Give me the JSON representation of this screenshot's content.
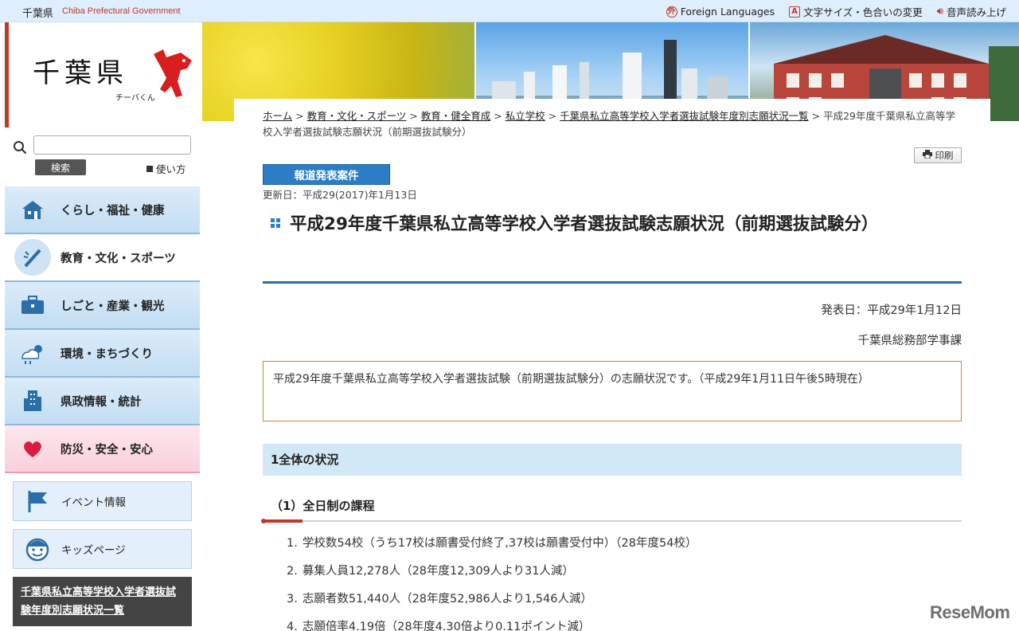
{
  "topbar": {
    "brand_ja": "千葉県",
    "brand_en": "Chiba Prefectural Government",
    "links": [
      "Foreign Languages",
      "文字サイズ・色合いの変更",
      "音声読み上げ"
    ]
  },
  "logo": {
    "text": "千葉県",
    "mascot_name": "チーバくん"
  },
  "search": {
    "placeholder": "",
    "button": "検索",
    "howto": "使い方"
  },
  "nav": [
    {
      "label": "くらし・福祉・健康",
      "icon": "house-icon"
    },
    {
      "label": "教育・文化・スポーツ",
      "icon": "pen-icon"
    },
    {
      "label": "しごと・産業・観光",
      "icon": "briefcase-icon"
    },
    {
      "label": "環境・まちづくり",
      "icon": "weather-icon"
    },
    {
      "label": "県政情報・統計",
      "icon": "building-icon"
    },
    {
      "label": "防災・安全・安心",
      "icon": "heart-icon"
    }
  ],
  "subnav": [
    {
      "label": "イベント情報",
      "icon": "flag-icon"
    },
    {
      "label": "キッズページ",
      "icon": "kid-face-icon"
    }
  ],
  "related_link": "千葉県私立高等学校入学者選抜試験年度別志願状況一覧",
  "breadcrumb": {
    "links": [
      "ホーム",
      "教育・文化・スポーツ",
      "教育・健全育成",
      "私立学校",
      "千葉県私立高等学校入学者選抜試験年度別志願状況一覧"
    ],
    "current": "平成29年度千葉県私立高等学校入学者選抜試験志願状況（前期選抜試験分）"
  },
  "print_label": "印刷",
  "badge": "報道発表案件",
  "updated": "更新日：平成29(2017)年1月13日",
  "page_title": "平成29年度千葉県私立高等学校入学者選抜試験志願状況（前期選抜試験分）",
  "publish_date": "発表日：平成29年1月12日",
  "department": "千葉県総務部学事課",
  "notice": "平成29年度千葉県私立高等学校入学者選抜試験（前期選抜試験分）の志願状況です。（平成29年1月11日午後5時現在）",
  "section_heading": "1全体の状況",
  "subsection_heading": "（1）全日制の課程",
  "list": [
    {
      "num": "1.",
      "text": "学校数54校（うち17校は願書受付終了,37校は願書受付中）（28年度54校）"
    },
    {
      "num": "2.",
      "text": "募集人員12,278人（28年度12,309人より31人減）"
    },
    {
      "num": "3.",
      "text": "志願者数51,440人（28年度52,986人より1,546人減）"
    },
    {
      "num": "4.",
      "text": "志願倍率4.19倍（28年度4.30倍より0.11ポイント減）"
    }
  ],
  "watermark": "ReseMom",
  "colors": {
    "accent_red": "#c0392b",
    "accent_blue": "#2b7ec6",
    "notice_border": "#d9822b"
  }
}
